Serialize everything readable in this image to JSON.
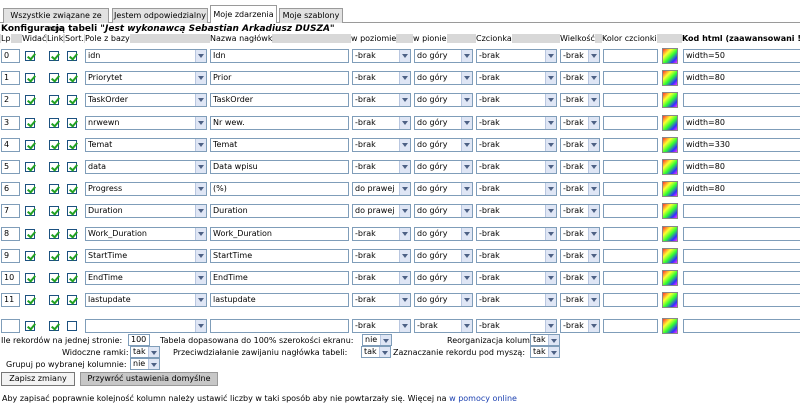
{
  "tabs": [
    {
      "label": "Wszystkie związane ze mną",
      "active": false
    },
    {
      "label": "Jestem odpowiedzialny",
      "active": false
    },
    {
      "label": "Moje zdarzenia",
      "active": true
    },
    {
      "label": "Moje szablony",
      "active": false
    }
  ],
  "caption": {
    "prefix": "Konfiguracja tabeli ",
    "author": "\"Jest wykonawcą Sebastian Arkadiusz DUSZA\""
  },
  "headers": {
    "lp": "Lp",
    "widac": "Widać",
    "link": "Link",
    "sort": "Sort.",
    "pole": "Pole z bazy",
    "nazwa": "Nazwa nagłówk",
    "poziom": "w poziomie",
    "pion": "w pionie",
    "czcionka": "Czcionka",
    "wielkosc": "Wielkość",
    "kolor": "Kolor czcionki",
    "kod": "Kod html (zaawansowani !!"
  },
  "rows": [
    {
      "lp": "0",
      "widac": true,
      "link": true,
      "sort": true,
      "pole": "idn",
      "nazwa": "Idn",
      "poziom": "-brak",
      "pion": "do góry",
      "czcionka": "-brak",
      "wielkosc": "-brak",
      "kolor": "",
      "kod": "width=50"
    },
    {
      "lp": "1",
      "widac": true,
      "link": true,
      "sort": true,
      "pole": "Priorytet",
      "nazwa": "Prior",
      "poziom": "-brak",
      "pion": "do góry",
      "czcionka": "-brak",
      "wielkosc": "-brak",
      "kolor": "",
      "kod": "width=80"
    },
    {
      "lp": "2",
      "widac": true,
      "link": true,
      "sort": true,
      "pole": "TaskOrder",
      "nazwa": "TaskOrder",
      "poziom": "-brak",
      "pion": "do góry",
      "czcionka": "-brak",
      "wielkosc": "-brak",
      "kolor": "",
      "kod": ""
    },
    {
      "lp": "3",
      "widac": true,
      "link": true,
      "sort": true,
      "pole": "nrwewn",
      "nazwa": "Nr wew.",
      "poziom": "-brak",
      "pion": "do góry",
      "czcionka": "-brak",
      "wielkosc": "-brak",
      "kolor": "",
      "kod": "width=80"
    },
    {
      "lp": "4",
      "widac": true,
      "link": true,
      "sort": true,
      "pole": "Temat",
      "nazwa": "Temat",
      "poziom": "-brak",
      "pion": "do góry",
      "czcionka": "-brak",
      "wielkosc": "-brak",
      "kolor": "",
      "kod": "width=330"
    },
    {
      "lp": "5",
      "widac": true,
      "link": true,
      "sort": true,
      "pole": "data",
      "nazwa": "Data wpisu",
      "poziom": "-brak",
      "pion": "do góry",
      "czcionka": "-brak",
      "wielkosc": "-brak",
      "kolor": "",
      "kod": "width=80"
    },
    {
      "lp": "6",
      "widac": true,
      "link": true,
      "sort": true,
      "pole": "Progress",
      "nazwa": "(%)",
      "poziom": "do prawej",
      "pion": "do góry",
      "czcionka": "-brak",
      "wielkosc": "-brak",
      "kolor": "",
      "kod": "width=80"
    },
    {
      "lp": "7",
      "widac": true,
      "link": true,
      "sort": true,
      "pole": "Duration",
      "nazwa": "Duration",
      "poziom": "do prawej",
      "pion": "do góry",
      "czcionka": "-brak",
      "wielkosc": "-brak",
      "kolor": "",
      "kod": ""
    },
    {
      "lp": "8",
      "widac": true,
      "link": true,
      "sort": true,
      "pole": "Work_Duration",
      "nazwa": "Work_Duration",
      "poziom": "-brak",
      "pion": "do góry",
      "czcionka": "-brak",
      "wielkosc": "-brak",
      "kolor": "",
      "kod": ""
    },
    {
      "lp": "9",
      "widac": true,
      "link": true,
      "sort": true,
      "pole": "StartTime",
      "nazwa": "StartTime",
      "poziom": "-brak",
      "pion": "do góry",
      "czcionka": "-brak",
      "wielkosc": "-brak",
      "kolor": "",
      "kod": ""
    },
    {
      "lp": "10",
      "widac": true,
      "link": true,
      "sort": true,
      "pole": "EndTime",
      "nazwa": "EndTime",
      "poziom": "-brak",
      "pion": "do góry",
      "czcionka": "-brak",
      "wielkosc": "-brak",
      "kolor": "",
      "kod": ""
    },
    {
      "lp": "11",
      "widac": true,
      "link": true,
      "sort": true,
      "pole": "lastupdate",
      "nazwa": "lastupdate",
      "poziom": "-brak",
      "pion": "do góry",
      "czcionka": "-brak",
      "wielkosc": "-brak",
      "kolor": "",
      "kod": ""
    },
    {
      "lp": "",
      "widac": true,
      "link": true,
      "sort": false,
      "pole": "",
      "nazwa": "",
      "poziom": "-brak",
      "pion": "-brak",
      "czcionka": "-brak",
      "wielkosc": "-brak",
      "kolor": "",
      "kod": ""
    }
  ],
  "options": {
    "records_label": "Ile rekordów na jednej stronie:",
    "records_value": "100",
    "fit_label": "Tabela dopasowana do 100% szerokości ekranu:",
    "fit_value": "nie",
    "reorg_label": "Reorganizacja kolumn:",
    "reorg_value": "tak",
    "frames_label": "Widoczne ramki:",
    "frames_value": "tak",
    "wrap_label": "Przeciwdziałanie zawijaniu nagłówka tabeli:",
    "wrap_value": "tak",
    "highlight_label": "Zaznaczanie rekordu pod myszą:",
    "highlight_value": "tak",
    "group_label": "Grupuj po wybranej kolumnie:",
    "group_value": "nie"
  },
  "buttons": {
    "save": "Zapisz zmiany",
    "restore": "Przywróć ustawienia domyślne"
  },
  "note": {
    "text": "Aby zapisać poprawnie kolejność kolumn należy ustawić liczby w taki sposób aby nie powtarzały się. Więcej na ",
    "link": "w pomocy online"
  }
}
